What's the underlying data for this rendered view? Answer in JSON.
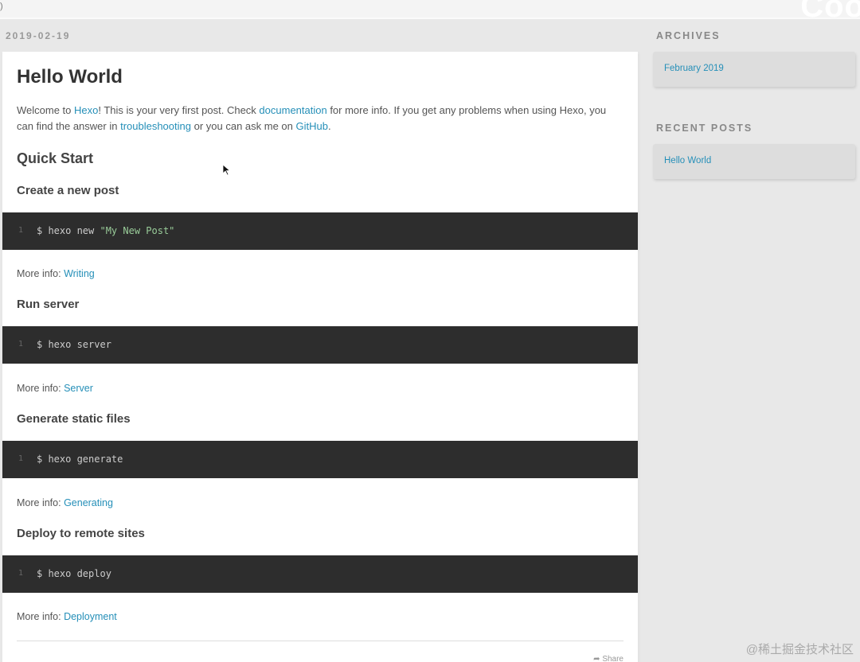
{
  "topbar": {
    "ghost_text": "Coo",
    "corner_mark": ")"
  },
  "article": {
    "date": "2019-02-19",
    "title": "Hello World",
    "intro": {
      "t1": "Welcome to ",
      "hexo_link": "Hexo",
      "t2": "! This is your very first post. Check ",
      "docs_link": "documentation",
      "t3": " for more info. If you get any problems when using Hexo, you can find the answer in ",
      "troubleshooting_link": "troubleshooting",
      "t4": " or you can ask me on ",
      "github_link": "GitHub",
      "t5": "."
    },
    "quick_start": "Quick Start",
    "more_info_label": "More info: ",
    "sections": [
      {
        "heading": "Create a new post",
        "line_no": "1",
        "cmd": "$ hexo new ",
        "cmd_str": "\"My New Post\"",
        "link": "Writing"
      },
      {
        "heading": "Run server",
        "line_no": "1",
        "cmd": "$ hexo server",
        "cmd_str": "",
        "link": "Server"
      },
      {
        "heading": "Generate static files",
        "line_no": "1",
        "cmd": "$ hexo generate",
        "cmd_str": "",
        "link": "Generating"
      },
      {
        "heading": "Deploy to remote sites",
        "line_no": "1",
        "cmd": "$ hexo deploy",
        "cmd_str": "",
        "link": "Deployment"
      }
    ],
    "share_label": "Share"
  },
  "sidebar": {
    "archives_title": "ARCHIVES",
    "archives_item": "February 2019",
    "recent_title": "RECENT POSTS",
    "recent_item": "Hello World"
  },
  "watermark": "@稀土掘金技术社区"
}
